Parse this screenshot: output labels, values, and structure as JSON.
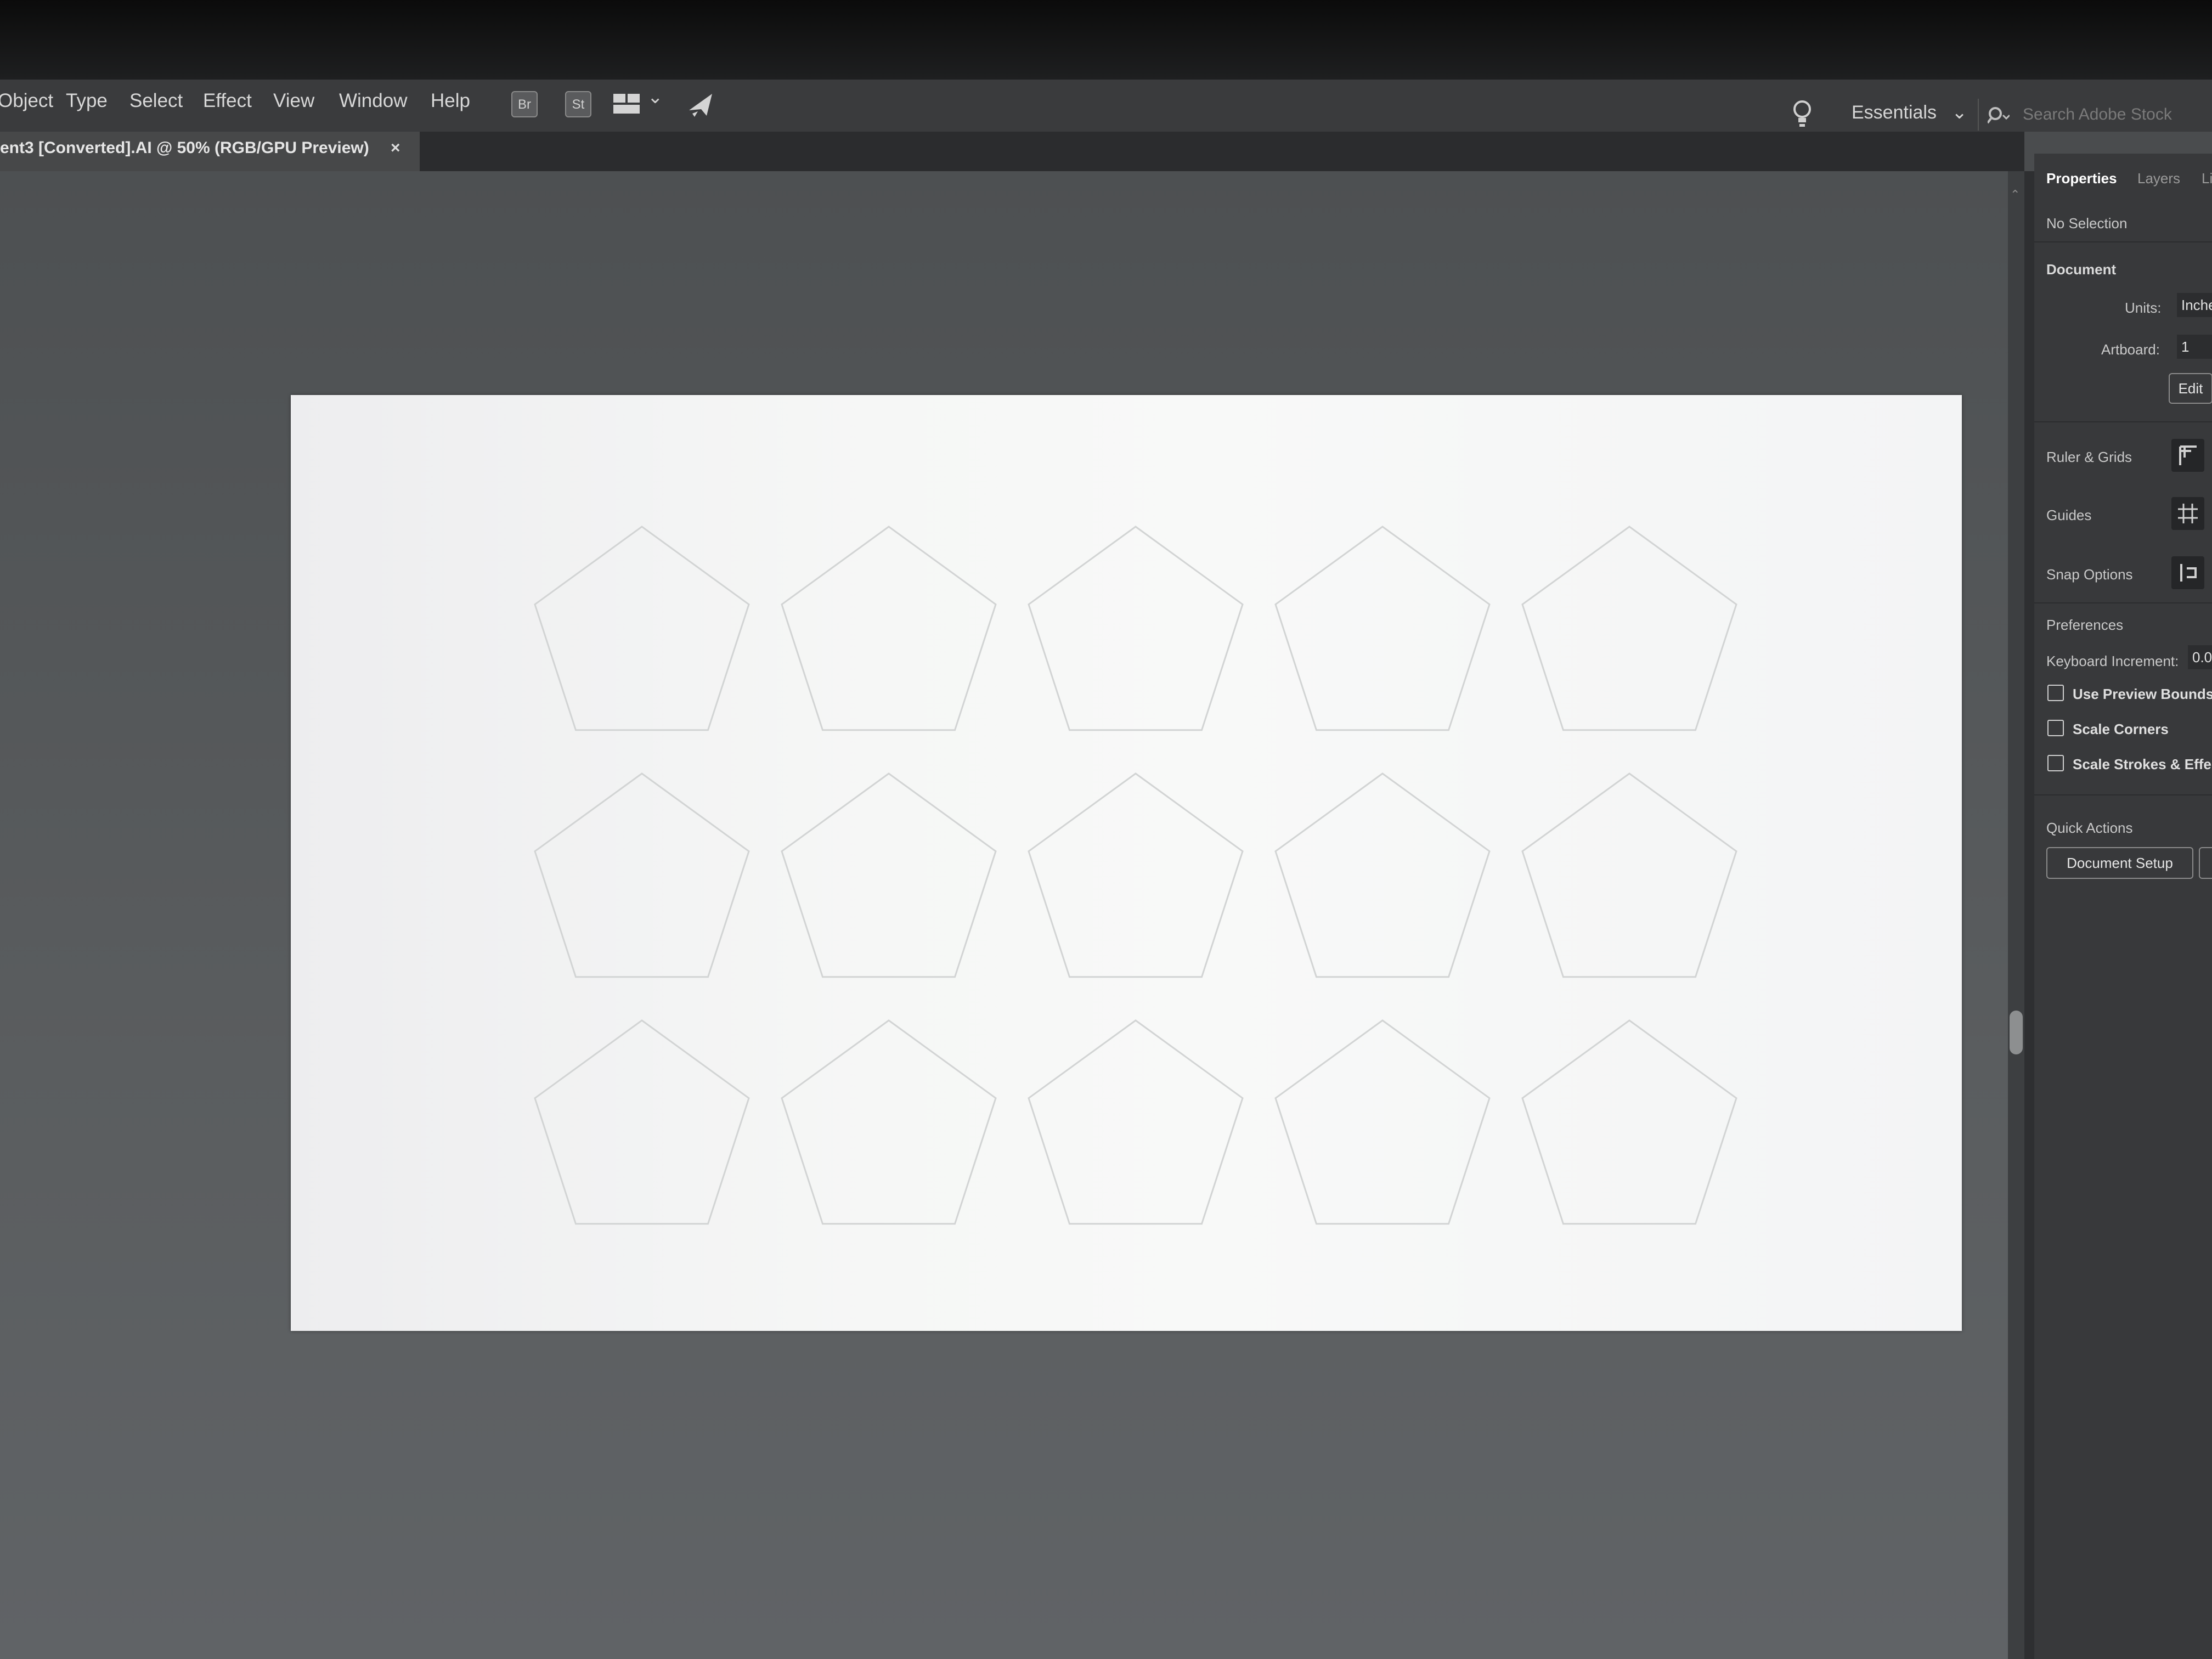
{
  "menubar": {
    "items": [
      "Object",
      "Type",
      "Select",
      "Effect",
      "View",
      "Window",
      "Help"
    ],
    "bridge_label": "Br",
    "stock_label": "St",
    "workspace": "Essentials",
    "search_placeholder": "Search Adobe Stock"
  },
  "document_tab": {
    "title": "ent3 [Converted].AI @ 50% (RGB/GPU Preview)",
    "close": "×"
  },
  "artboard": {
    "shape": "pentagon",
    "rows": 3,
    "columns": 5,
    "stroke_color": "#d2d4d4",
    "background": "#f5f6f5"
  },
  "properties_panel": {
    "tabs": [
      "Properties",
      "Layers",
      "Li"
    ],
    "selection_status": "No Selection",
    "document_header": "Document",
    "units_label": "Units:",
    "units_value": "Inches",
    "artboard_label": "Artboard:",
    "artboard_value": "1",
    "edit_button": "Edit",
    "ruler_grids": "Ruler & Grids",
    "guides": "Guides",
    "snap_options": "Snap Options",
    "preferences": "Preferences",
    "keyboard_increment_label": "Keyboard Increment:",
    "keyboard_increment_value": "0.0",
    "checkboxes": [
      "Use Preview Bounds",
      "Scale Corners",
      "Scale Strokes & Effects"
    ],
    "quick_actions": "Quick Actions",
    "document_setup_button": "Document Setup"
  }
}
